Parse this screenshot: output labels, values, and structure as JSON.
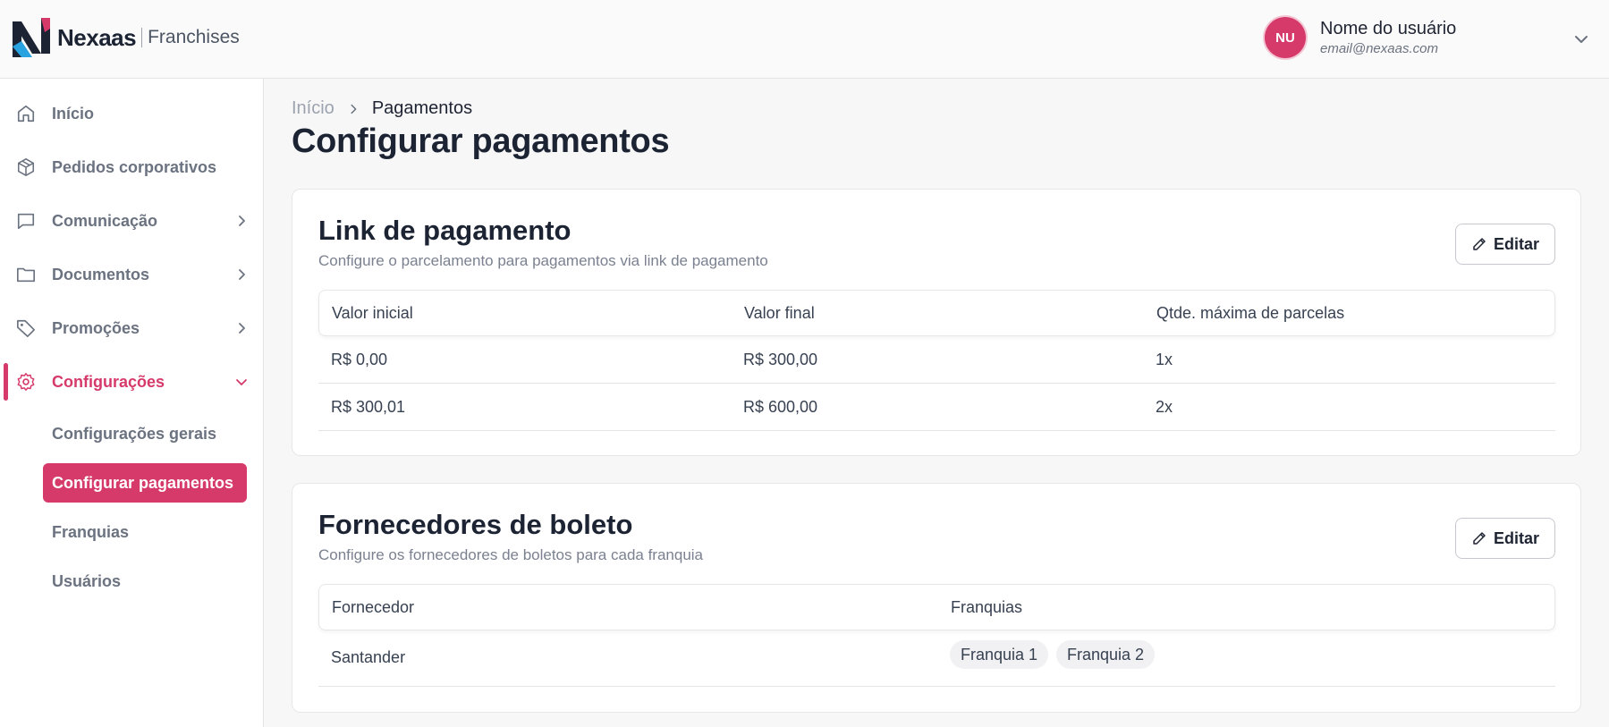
{
  "header": {
    "brand": "Nexaas",
    "brand_sub": "Franchises",
    "user": {
      "initials": "NU",
      "name": "Nome do usuário",
      "email": "email@nexaas.com"
    }
  },
  "colors": {
    "accent": "#d63a6a",
    "logo_dark": "#1c2333",
    "logo_blue": "#2aa4e0"
  },
  "sidebar": {
    "items": [
      {
        "label": "Início",
        "icon": "home-icon"
      },
      {
        "label": "Pedidos corporativos",
        "icon": "box-icon"
      },
      {
        "label": "Comunicação",
        "icon": "chat-icon"
      },
      {
        "label": "Documentos",
        "icon": "folder-icon"
      },
      {
        "label": "Promoções",
        "icon": "tag-icon"
      },
      {
        "label": "Configurações",
        "icon": "gear-icon"
      }
    ],
    "subitems": [
      {
        "label": "Configurações gerais"
      },
      {
        "label": "Configurar pagamentos"
      },
      {
        "label": "Franquias"
      },
      {
        "label": "Usuários"
      }
    ]
  },
  "breadcrumb": {
    "home": "Início",
    "current": "Pagamentos"
  },
  "page": {
    "title": "Configurar pagamentos"
  },
  "link_card": {
    "title": "Link de pagamento",
    "subtitle": "Configure o parcelamento para pagamentos via link de pagamento",
    "edit_label": "Editar",
    "columns": [
      "Valor inicial",
      "Valor final",
      "Qtde. máxima de parcelas"
    ],
    "rows": [
      [
        "R$ 0,00",
        "R$ 300,00",
        "1x"
      ],
      [
        "R$ 300,01",
        "R$ 600,00",
        "2x"
      ]
    ]
  },
  "boleto_card": {
    "title": "Fornecedores de boleto",
    "subtitle": "Configure os fornecedores de boletos para cada franquia",
    "edit_label": "Editar",
    "columns": [
      "Fornecedor",
      "Franquias"
    ],
    "rows": [
      {
        "supplier": "Santander",
        "franchises": [
          "Franquia 1",
          "Franquia 2"
        ]
      }
    ]
  }
}
